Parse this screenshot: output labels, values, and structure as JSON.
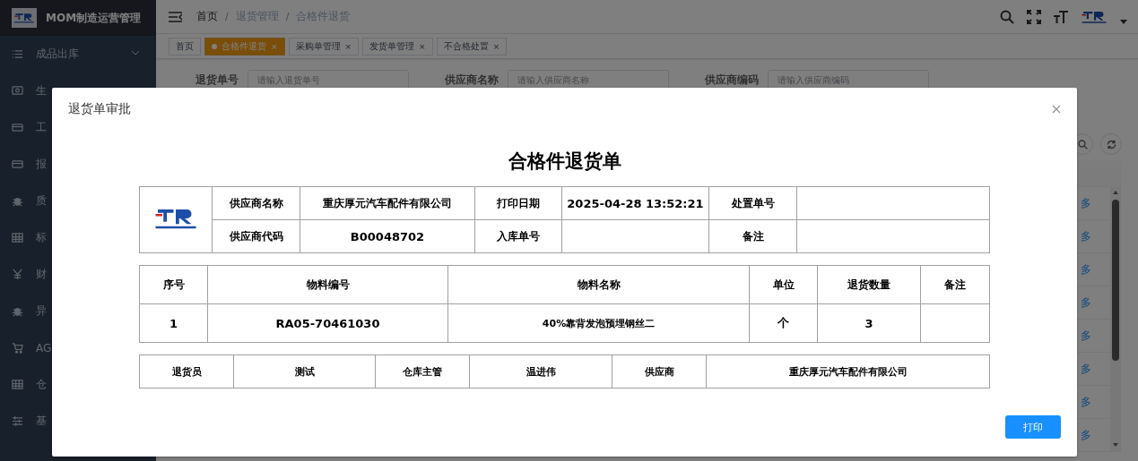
{
  "sidebar": {
    "title": "MOM制造运营管理",
    "items": [
      {
        "label": "成品出库",
        "expanded": false
      },
      {
        "label": "生"
      },
      {
        "label": "工"
      },
      {
        "label": "报"
      },
      {
        "label": "质"
      },
      {
        "label": "标"
      },
      {
        "label": "财"
      },
      {
        "label": "异"
      },
      {
        "label": "AG"
      },
      {
        "label": "仓"
      },
      {
        "label": "基"
      }
    ]
  },
  "navbar": {
    "separator": "/",
    "breadcrumbs": [
      {
        "label": "首页",
        "link": true
      },
      {
        "label": "退货管理",
        "link": false
      },
      {
        "label": "合格件退货",
        "link": false
      }
    ]
  },
  "tags": [
    {
      "label": "首页",
      "selected": false
    },
    {
      "label": "合格件退货",
      "selected": true,
      "close": "×"
    },
    {
      "label": "采购单管理",
      "selected": false,
      "close": "×"
    },
    {
      "label": "发货单管理",
      "selected": false,
      "close": "×"
    },
    {
      "label": "不合格处置",
      "selected": false,
      "close": "×"
    }
  ],
  "search": [
    {
      "label": "退货单号",
      "placeholder": "请输入退货单号"
    },
    {
      "label": "供应商名称",
      "placeholder": "请输入供应商名称"
    },
    {
      "label": "供应商编码",
      "placeholder": "请输入供应商编码"
    }
  ],
  "table": {
    "action_cells": [
      "多",
      "多",
      "多",
      "多",
      "多",
      "多",
      "多",
      "多"
    ]
  },
  "modal": {
    "title": "退货单审批",
    "document": {
      "title": "合格件退货单",
      "info": [
        [
          {
            "label": "供应商名称",
            "value": "重庆厚元汽车配件有限公司"
          },
          {
            "label": "打印日期",
            "value": "2025-04-28 13:52:21"
          },
          {
            "label": "处置单号"
          }
        ],
        [
          {
            "label": "供应商代码",
            "value": "B00048702"
          },
          {
            "label": "入库单号"
          },
          {
            "label": "备注"
          }
        ]
      ],
      "items": {
        "columns": [
          "序号",
          "物料编号",
          "物料名称",
          "单位",
          "退货数量",
          "备注"
        ],
        "rows": [
          [
            "1",
            "RA05-70461030",
            "40%靠背发泡预埋钢丝二",
            "个",
            "3",
            null
          ]
        ]
      },
      "signatures": [
        {
          "label": "退货员",
          "value": "测试"
        },
        {
          "label": "仓库主管",
          "value": "温进伟"
        },
        {
          "label": "供应商",
          "value": "重庆厚元汽车配件有限公司"
        }
      ]
    },
    "buttons": [
      "打印"
    ]
  }
}
